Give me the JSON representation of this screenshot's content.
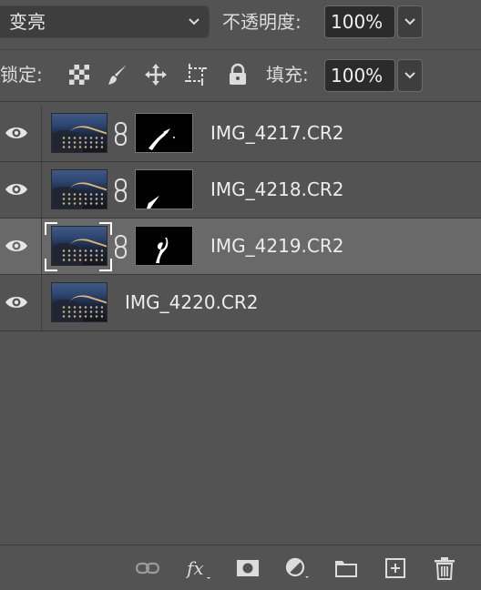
{
  "blend_mode": {
    "selected": "变亮"
  },
  "opacity": {
    "label": "不透明度:",
    "value": "100%"
  },
  "lock": {
    "label": "锁定:",
    "icons": [
      "lock-transparent-icon",
      "lock-image-icon",
      "lock-position-icon",
      "lock-artboard-icon",
      "lock-all-icon"
    ]
  },
  "fill": {
    "label": "填充:",
    "value": "100%"
  },
  "layers": [
    {
      "name": "IMG_4217.CR2",
      "visible": true,
      "selected": false,
      "has_mask": true
    },
    {
      "name": "IMG_4218.CR2",
      "visible": true,
      "selected": false,
      "has_mask": true
    },
    {
      "name": "IMG_4219.CR2",
      "visible": true,
      "selected": true,
      "has_mask": true
    },
    {
      "name": "IMG_4220.CR2",
      "visible": true,
      "selected": false,
      "has_mask": false
    }
  ],
  "bottom_icons": [
    "link-layers-icon",
    "fx-icon",
    "add-mask-icon",
    "adjustment-icon",
    "group-folder-icon",
    "new-layer-icon",
    "trash-icon"
  ],
  "colors": {
    "panel": "#535353",
    "selected_row": "#696969",
    "field": "#2b2b2b"
  }
}
